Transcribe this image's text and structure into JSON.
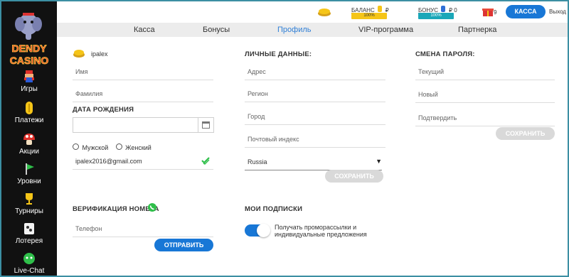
{
  "brand": {
    "logo_text": "DENDY CASINO"
  },
  "sidebar": {
    "items": [
      {
        "label": "Игры",
        "icon": "mario-icon"
      },
      {
        "label": "Платежи",
        "icon": "coin-icon"
      },
      {
        "label": "Акции",
        "icon": "mushroom-icon"
      },
      {
        "label": "Уровни",
        "icon": "flag-icon"
      },
      {
        "label": "Турниры",
        "icon": "trophy-icon"
      },
      {
        "label": "Лотерея",
        "icon": "ticket-icon"
      },
      {
        "label": "Live-Chat",
        "icon": "chat-icon"
      }
    ]
  },
  "topbar": {
    "balance_label": "БАЛАНС",
    "balance_value": "₽",
    "balance_progress": "100%",
    "bonus_label": "БОНУС",
    "bonus_value": "₽ 0",
    "bonus_progress": "100%",
    "gift_count": "9",
    "cashier_button": "КАССА",
    "logout_link": "Выход"
  },
  "tabs": [
    "Касса",
    "Бонусы",
    "Профиль",
    "VIP-программа",
    "Партнерка"
  ],
  "active_tab": 2,
  "profile": {
    "username": "ipalex",
    "name_placeholder": "Имя",
    "surname_placeholder": "Фамилия",
    "birth_heading": "ДАТА РОЖДЕНИЯ",
    "gender_male": "Мужской",
    "gender_female": "Женский",
    "email": "ipalex2016@gmail.com",
    "verify_heading": "ВЕРИФИКАЦИЯ НОМЕРА",
    "phone_placeholder": "Телефон",
    "send_button": "ОТПРАВИТЬ"
  },
  "personal": {
    "heading": "ЛИЧНЫЕ ДАННЫЕ:",
    "address_placeholder": "Адрес",
    "region_placeholder": "Регион",
    "city_placeholder": "Город",
    "zip_placeholder": "Почтовый индекс",
    "country": "Russia",
    "save_button": "СОХРАНИТЬ"
  },
  "subscriptions": {
    "heading": "МОИ ПОДПИСКИ",
    "promo_text_line1": "Получать проморассылки и",
    "promo_text_line2": "индивидуальные предложения"
  },
  "password": {
    "heading": "СМЕНА ПАРОЛЯ:",
    "current_placeholder": "Текущий",
    "new_placeholder": "Новый",
    "confirm_placeholder": "Подтвердить",
    "save_button": "СОХРАНИТЬ"
  },
  "colors": {
    "accent": "#1877d6",
    "sidebar": "#111111",
    "yellow": "#f5c518",
    "teal": "#1aa7b8"
  }
}
